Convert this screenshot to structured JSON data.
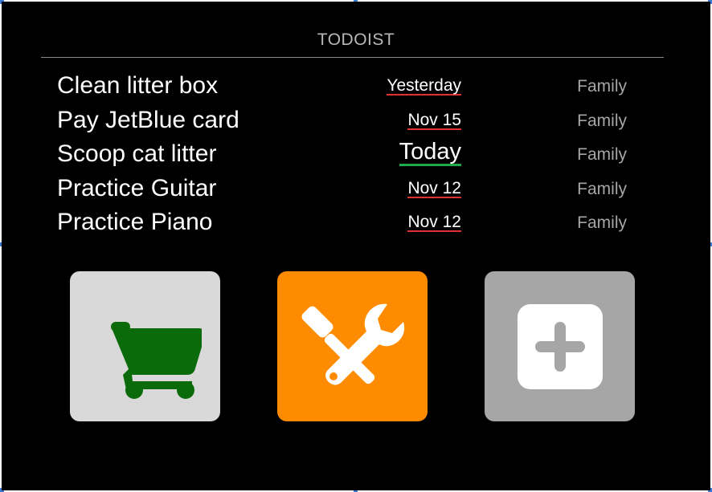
{
  "header": {
    "title": "TODOIST"
  },
  "tasks": [
    {
      "title": "Clean litter box",
      "due": "Yesterday",
      "project": "Family",
      "due_status": "overdue"
    },
    {
      "title": "Pay JetBlue card",
      "due": "Nov 15",
      "project": "Family",
      "due_status": "overdue"
    },
    {
      "title": "Scoop cat litter",
      "due": "Today",
      "project": "Family",
      "due_status": "today"
    },
    {
      "title": "Practice Guitar",
      "due": "Nov 12",
      "project": "Family",
      "due_status": "overdue"
    },
    {
      "title": "Practice Piano",
      "due": "Nov 12",
      "project": "Family",
      "due_status": "overdue"
    }
  ],
  "tiles": [
    {
      "icon": "shopping-cart-icon",
      "background": "#d9d9d9",
      "icon_color": "#0b6b0b"
    },
    {
      "icon": "tools-icon",
      "background": "#ff8c00",
      "icon_color": "#ffffff"
    },
    {
      "icon": "add-icon",
      "background": "#a6a6a6",
      "icon_color": "#ffffff"
    }
  ],
  "colors": {
    "overdue_underline": "#e03030",
    "today_underline": "#1faa4b",
    "selection_handle": "#3a7bd5"
  }
}
